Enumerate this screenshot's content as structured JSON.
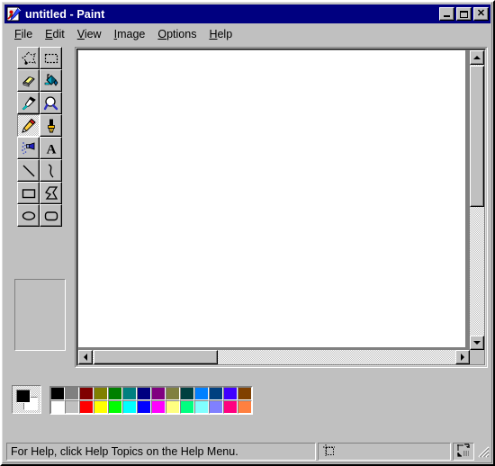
{
  "window": {
    "title": "untitled - Paint",
    "icon": "paint-app-icon",
    "buttons": [
      {
        "name": "minimize",
        "label": "_"
      },
      {
        "name": "maximize",
        "label": "□"
      },
      {
        "name": "close",
        "label": "✕"
      }
    ]
  },
  "menu": {
    "items": [
      {
        "name": "file",
        "accel": "F",
        "rest": "ile"
      },
      {
        "name": "edit",
        "accel": "E",
        "rest": "dit"
      },
      {
        "name": "view",
        "accel": "V",
        "rest": "iew"
      },
      {
        "name": "image",
        "accel": "I",
        "rest": "mage"
      },
      {
        "name": "options",
        "accel": "O",
        "rest": "ptions"
      },
      {
        "name": "help",
        "accel": "H",
        "rest": "elp"
      }
    ]
  },
  "toolbox": {
    "selected_tool": "pencil",
    "tools": [
      {
        "name": "free-form-select",
        "label": "Free-Form Select"
      },
      {
        "name": "select",
        "label": "Select"
      },
      {
        "name": "eraser",
        "label": "Eraser/Color Eraser"
      },
      {
        "name": "fill",
        "label": "Fill With Color"
      },
      {
        "name": "pick-color",
        "label": "Pick Color"
      },
      {
        "name": "magnifier",
        "label": "Magnifier"
      },
      {
        "name": "pencil",
        "label": "Pencil"
      },
      {
        "name": "brush",
        "label": "Brush"
      },
      {
        "name": "airbrush",
        "label": "Airbrush"
      },
      {
        "name": "text",
        "label": "Text"
      },
      {
        "name": "line",
        "label": "Line"
      },
      {
        "name": "curve",
        "label": "Curve"
      },
      {
        "name": "rectangle",
        "label": "Rectangle"
      },
      {
        "name": "polygon",
        "label": "Polygon"
      },
      {
        "name": "ellipse",
        "label": "Ellipse"
      },
      {
        "name": "rounded-rectangle",
        "label": "Rounded Rectangle"
      }
    ]
  },
  "canvas": {
    "background": "#ffffff"
  },
  "scrollbars": {
    "vertical": {
      "thumb_position_percent": 0,
      "thumb_size_percent": 48
    },
    "horizontal": {
      "thumb_position_percent": 0,
      "thumb_size_percent": 33
    }
  },
  "palette": {
    "foreground_color": "#000000",
    "background_color": "#ffffff",
    "row1": [
      "#000000",
      "#808080",
      "#800000",
      "#808000",
      "#008000",
      "#008080",
      "#000080",
      "#800080",
      "#808040",
      "#004040",
      "#0080ff",
      "#004080",
      "#4000ff",
      "#804000"
    ],
    "row2": [
      "#ffffff",
      "#c0c0c0",
      "#ff0000",
      "#ffff00",
      "#00ff00",
      "#00ffff",
      "#0000ff",
      "#ff00ff",
      "#ffff80",
      "#00ff80",
      "#80ffff",
      "#8080ff",
      "#ff0080",
      "#ff8040"
    ]
  },
  "status": {
    "help_text": "For Help, click Help Topics on the Help Menu.",
    "position_text": "",
    "size_text": "",
    "size_icon": "canvas-size-icon",
    "cursor_icon": "cursor-position-icon"
  }
}
